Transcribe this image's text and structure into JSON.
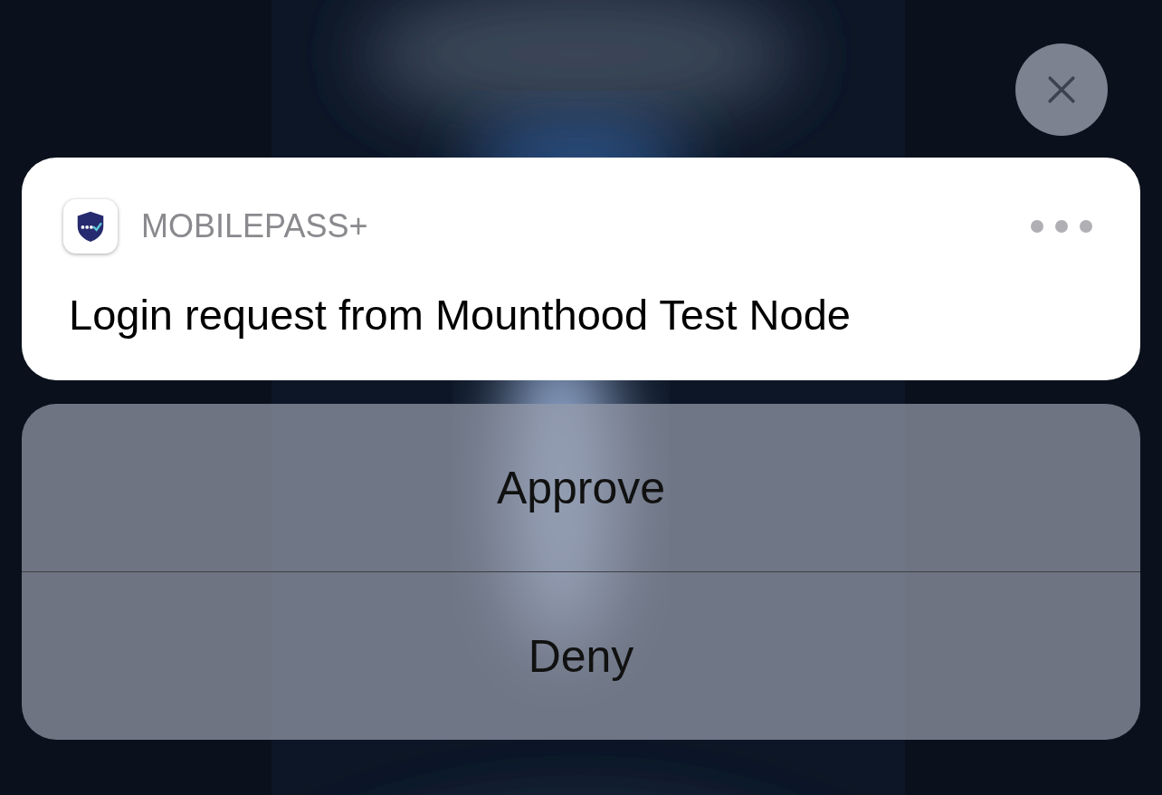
{
  "notification": {
    "app_name": "MOBILEPASS+",
    "message": "Login request from Mounthood Test Node"
  },
  "actions": [
    {
      "label": "Approve"
    },
    {
      "label": "Deny"
    }
  ]
}
